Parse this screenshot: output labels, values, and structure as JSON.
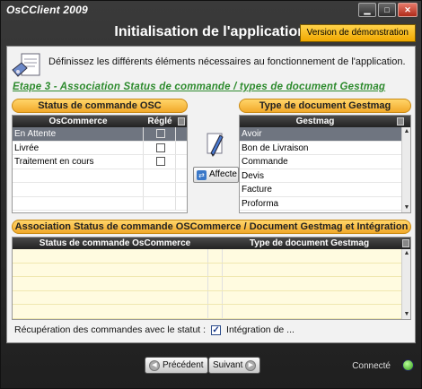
{
  "window": {
    "app_title": "OsCClient 2009",
    "minimize_glyph": "▁",
    "maximize_glyph": "□",
    "close_glyph": "✕"
  },
  "header": {
    "title": "Initialisation de l'application",
    "demo_badge": "Version de démonstration"
  },
  "intro": {
    "text": "Définissez les différents éléments nécessaires au fonctionnement de l'application.",
    "icon": "document-settings-icon"
  },
  "step": {
    "title": "Etape 3 - Association Status de commande / types de document Gestmag"
  },
  "osc_status": {
    "header": "Status de commande OSC",
    "columns": [
      "OsCommerce",
      "Réglé"
    ],
    "rows": [
      {
        "label": "En Attente",
        "checked": false
      },
      {
        "label": "Livrée",
        "checked": false
      },
      {
        "label": "Traitement en cours",
        "checked": false
      }
    ]
  },
  "doc_type": {
    "header": "Type de document Gestmag",
    "column": "Gestmag",
    "rows": [
      "Avoir",
      "Bon de Livraison",
      "Commande",
      "Devis",
      "Facture",
      "Proforma"
    ]
  },
  "affecte_button": {
    "label": "Affecte",
    "icon": "link-icon"
  },
  "association": {
    "header": "Association Status de commande OSCommerce / Document Gestmag et Intégration",
    "columns": [
      "Status de commande OsCommerce",
      "Type de document Gestmag"
    ]
  },
  "recuperation": {
    "label": "Récupération des commandes avec le statut :",
    "option": "Intégration de ...",
    "checked": true
  },
  "footer": {
    "previous": "Précédent",
    "next": "Suivant",
    "status": "Connecté"
  },
  "colors": {
    "accent_orange": "#f2a92a",
    "selected_row": "#6f7580",
    "step_green": "#2e8b2e",
    "led_green": "#2f9a14"
  }
}
